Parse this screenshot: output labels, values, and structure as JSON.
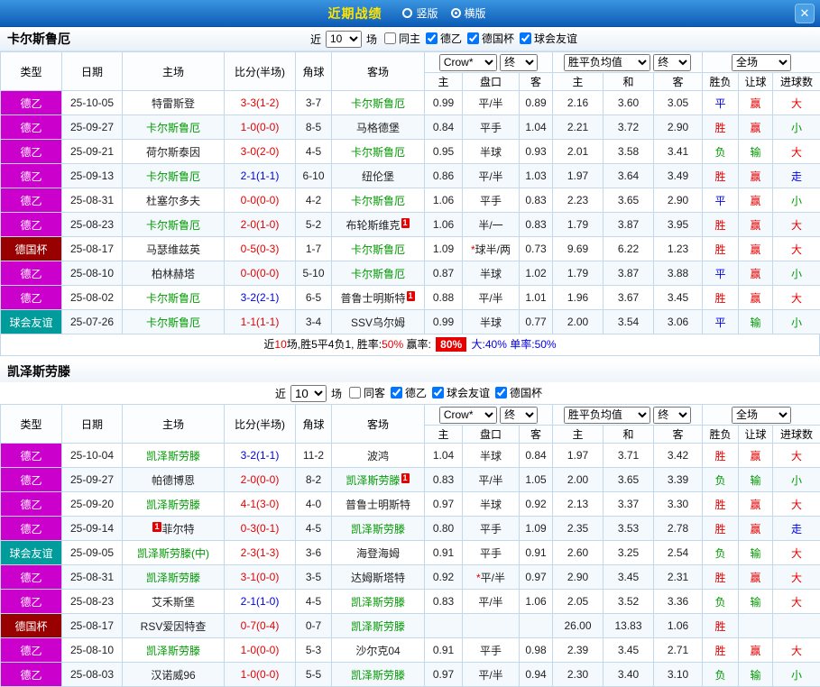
{
  "topbar": {
    "title": "近期战绩",
    "views": [
      {
        "label": "竖版",
        "selected": false
      },
      {
        "label": "横版",
        "selected": true
      }
    ],
    "close": "✕"
  },
  "filter_labels": {
    "near": "近",
    "games": "场"
  },
  "header_labels": {
    "type": "类型",
    "date": "日期",
    "home": "主场",
    "score": "比分(半场)",
    "corner": "角球",
    "away": "客场",
    "odds_main": "主",
    "odds_handicap": "盘口",
    "odds_away": "客",
    "eu_home": "主",
    "eu_draw": "和",
    "eu_away": "客",
    "res_wl": "胜负",
    "res_handicap": "让球",
    "res_goals": "进球数"
  },
  "selects": {
    "odds_source": "Crow*",
    "final1": "终",
    "europe": "胜平负均值",
    "final2": "终",
    "scope": "全场"
  },
  "colors": {
    "type_bg": {
      "德乙": "#cc00cc",
      "德国杯": "#990000",
      "球会友谊": "#009b9b"
    },
    "result_color": {
      "胜": "#e60000",
      "平": "#0000e6",
      "负": "#009900",
      "赢": "#e60000",
      "输": "#009900",
      "走": "#0000e6",
      "大": "#e60000",
      "小": "#009900"
    },
    "score_red": "#e60000",
    "score_blue": "#0000e6",
    "team_green": "#009900"
  },
  "sections": [
    {
      "team": "卡尔斯鲁厄",
      "filters": {
        "recent": "10",
        "checkboxes": [
          {
            "label": "同主",
            "checked": false
          },
          {
            "label": "德乙",
            "checked": true
          },
          {
            "label": "德国杯",
            "checked": true
          },
          {
            "label": "球会友谊",
            "checked": true
          }
        ]
      },
      "rows": [
        {
          "type": "德乙",
          "date": "25-10-05",
          "home": "特雷斯登",
          "home_green": false,
          "home_badge": "",
          "home_badge_pre": false,
          "score": "3-3(1-2)",
          "score_color": "red",
          "corner": "3-7",
          "away": "卡尔斯鲁厄",
          "away_green": true,
          "away_badge": "",
          "odds": [
            "0.99",
            "平/半",
            "0.89"
          ],
          "eu": [
            "2.16",
            "3.60",
            "3.05"
          ],
          "res": [
            "平",
            "赢",
            "大"
          ]
        },
        {
          "type": "德乙",
          "date": "25-09-27",
          "home": "卡尔斯鲁厄",
          "home_green": true,
          "home_badge": "",
          "home_badge_pre": false,
          "score": "1-0(0-0)",
          "score_color": "red",
          "corner": "8-5",
          "away": "马格德堡",
          "away_green": false,
          "away_badge": "",
          "odds": [
            "0.84",
            "平手",
            "1.04"
          ],
          "eu": [
            "2.21",
            "3.72",
            "2.90"
          ],
          "res": [
            "胜",
            "赢",
            "小"
          ]
        },
        {
          "type": "德乙",
          "date": "25-09-21",
          "home": "荷尔斯泰因",
          "home_green": false,
          "home_badge": "",
          "home_badge_pre": false,
          "score": "3-0(2-0)",
          "score_color": "red",
          "corner": "4-5",
          "away": "卡尔斯鲁厄",
          "away_green": true,
          "away_badge": "",
          "odds": [
            "0.95",
            "半球",
            "0.93"
          ],
          "eu": [
            "2.01",
            "3.58",
            "3.41"
          ],
          "res": [
            "负",
            "输",
            "大"
          ]
        },
        {
          "type": "德乙",
          "date": "25-09-13",
          "home": "卡尔斯鲁厄",
          "home_green": true,
          "home_badge": "",
          "home_badge_pre": false,
          "score": "2-1(1-1)",
          "score_color": "blue",
          "corner": "6-10",
          "away": "纽伦堡",
          "away_green": false,
          "away_badge": "",
          "odds": [
            "0.86",
            "平/半",
            "1.03"
          ],
          "eu": [
            "1.97",
            "3.64",
            "3.49"
          ],
          "res": [
            "胜",
            "赢",
            "走"
          ]
        },
        {
          "type": "德乙",
          "date": "25-08-31",
          "home": "杜塞尔多夫",
          "home_green": false,
          "home_badge": "",
          "home_badge_pre": false,
          "score": "0-0(0-0)",
          "score_color": "red",
          "corner": "4-2",
          "away": "卡尔斯鲁厄",
          "away_green": true,
          "away_badge": "",
          "odds": [
            "1.06",
            "平手",
            "0.83"
          ],
          "eu": [
            "2.23",
            "3.65",
            "2.90"
          ],
          "res": [
            "平",
            "赢",
            "小"
          ]
        },
        {
          "type": "德乙",
          "date": "25-08-23",
          "home": "卡尔斯鲁厄",
          "home_green": true,
          "home_badge": "",
          "home_badge_pre": false,
          "score": "2-0(1-0)",
          "score_color": "red",
          "corner": "5-2",
          "away": "布轮斯维克",
          "away_green": false,
          "away_badge": "1",
          "odds": [
            "1.06",
            "半/一",
            "0.83"
          ],
          "eu": [
            "1.79",
            "3.87",
            "3.95"
          ],
          "res": [
            "胜",
            "赢",
            "大"
          ]
        },
        {
          "type": "德国杯",
          "date": "25-08-17",
          "home": "马瑟维兹英",
          "home_green": false,
          "home_badge": "",
          "home_badge_pre": false,
          "score": "0-5(0-3)",
          "score_color": "red",
          "corner": "1-7",
          "away": "卡尔斯鲁厄",
          "away_green": true,
          "away_badge": "",
          "odds": [
            "1.09",
            "*球半/两",
            "0.73"
          ],
          "eu": [
            "9.69",
            "6.22",
            "1.23"
          ],
          "res": [
            "胜",
            "赢",
            "大"
          ]
        },
        {
          "type": "德乙",
          "date": "25-08-10",
          "home": "柏林赫塔",
          "home_green": false,
          "home_badge": "",
          "home_badge_pre": false,
          "score": "0-0(0-0)",
          "score_color": "red",
          "corner": "5-10",
          "away": "卡尔斯鲁厄",
          "away_green": true,
          "away_badge": "",
          "odds": [
            "0.87",
            "半球",
            "1.02"
          ],
          "eu": [
            "1.79",
            "3.87",
            "3.88"
          ],
          "res": [
            "平",
            "赢",
            "小"
          ]
        },
        {
          "type": "德乙",
          "date": "25-08-02",
          "home": "卡尔斯鲁厄",
          "home_green": true,
          "home_badge": "",
          "home_badge_pre": false,
          "score": "3-2(2-1)",
          "score_color": "blue",
          "corner": "6-5",
          "away": "普鲁士明斯特",
          "away_green": false,
          "away_badge": "1",
          "odds": [
            "0.88",
            "平/半",
            "1.01"
          ],
          "eu": [
            "1.96",
            "3.67",
            "3.45"
          ],
          "res": [
            "胜",
            "赢",
            "大"
          ]
        },
        {
          "type": "球会友谊",
          "date": "25-07-26",
          "home": "卡尔斯鲁厄",
          "home_green": true,
          "home_badge": "",
          "home_badge_pre": false,
          "score": "1-1(1-1)",
          "score_color": "red",
          "corner": "3-4",
          "away": "SSV乌尔姆",
          "away_green": false,
          "away_badge": "",
          "odds": [
            "0.99",
            "半球",
            "0.77"
          ],
          "eu": [
            "2.00",
            "3.54",
            "3.06"
          ],
          "res": [
            "平",
            "输",
            "小"
          ]
        }
      ],
      "summary": [
        {
          "text": "近",
          "cls": "plain"
        },
        {
          "text": "10",
          "cls": "red"
        },
        {
          "text": "场,胜5平4负1, 胜率:",
          "cls": "plain"
        },
        {
          "text": "50%",
          "cls": "red"
        },
        {
          "text": " 赢率: ",
          "cls": "plain"
        },
        {
          "text": "80%",
          "cls": "badge"
        },
        {
          "text": " 大:",
          "cls": "blue"
        },
        {
          "text": "40%",
          "cls": "blue"
        },
        {
          "text": " 单率:",
          "cls": "blue"
        },
        {
          "text": "50%",
          "cls": "blue"
        }
      ]
    },
    {
      "team": "凯泽斯劳滕",
      "filters": {
        "recent": "10",
        "checkboxes": [
          {
            "label": "同客",
            "checked": false
          },
          {
            "label": "德乙",
            "checked": true
          },
          {
            "label": "球会友谊",
            "checked": true
          },
          {
            "label": "德国杯",
            "checked": true
          }
        ]
      },
      "rows": [
        {
          "type": "德乙",
          "date": "25-10-04",
          "home": "凯泽斯劳滕",
          "home_green": true,
          "home_badge": "",
          "home_badge_pre": false,
          "score": "3-2(1-1)",
          "score_color": "blue",
          "corner": "11-2",
          "away": "波鸿",
          "away_green": false,
          "away_badge": "",
          "odds": [
            "1.04",
            "半球",
            "0.84"
          ],
          "eu": [
            "1.97",
            "3.71",
            "3.42"
          ],
          "res": [
            "胜",
            "赢",
            "大"
          ]
        },
        {
          "type": "德乙",
          "date": "25-09-27",
          "home": "帕德博恩",
          "home_green": false,
          "home_badge": "",
          "home_badge_pre": false,
          "score": "2-0(0-0)",
          "score_color": "red",
          "corner": "8-2",
          "away": "凯泽斯劳滕",
          "away_green": true,
          "away_badge": "1",
          "odds": [
            "0.83",
            "平/半",
            "1.05"
          ],
          "eu": [
            "2.00",
            "3.65",
            "3.39"
          ],
          "res": [
            "负",
            "输",
            "小"
          ]
        },
        {
          "type": "德乙",
          "date": "25-09-20",
          "home": "凯泽斯劳滕",
          "home_green": true,
          "home_badge": "",
          "home_badge_pre": false,
          "score": "4-1(3-0)",
          "score_color": "red",
          "corner": "4-0",
          "away": "普鲁士明斯特",
          "away_green": false,
          "away_badge": "",
          "odds": [
            "0.97",
            "半球",
            "0.92"
          ],
          "eu": [
            "2.13",
            "3.37",
            "3.30"
          ],
          "res": [
            "胜",
            "赢",
            "大"
          ]
        },
        {
          "type": "德乙",
          "date": "25-09-14",
          "home": "菲尔特",
          "home_green": false,
          "home_badge": "1",
          "home_badge_pre": true,
          "score": "0-3(0-1)",
          "score_color": "red",
          "corner": "4-5",
          "away": "凯泽斯劳滕",
          "away_green": true,
          "away_badge": "",
          "odds": [
            "0.80",
            "平手",
            "1.09"
          ],
          "eu": [
            "2.35",
            "3.53",
            "2.78"
          ],
          "res": [
            "胜",
            "赢",
            "走"
          ]
        },
        {
          "type": "球会友谊",
          "date": "25-09-05",
          "home": "凯泽斯劳滕(中)",
          "home_green": true,
          "home_badge": "",
          "home_badge_pre": false,
          "score": "2-3(1-3)",
          "score_color": "red",
          "corner": "3-6",
          "away": "海登海姆",
          "away_green": false,
          "away_badge": "",
          "odds": [
            "0.91",
            "平手",
            "0.91"
          ],
          "eu": [
            "2.60",
            "3.25",
            "2.54"
          ],
          "res": [
            "负",
            "输",
            "大"
          ]
        },
        {
          "type": "德乙",
          "date": "25-08-31",
          "home": "凯泽斯劳滕",
          "home_green": true,
          "home_badge": "",
          "home_badge_pre": false,
          "score": "3-1(0-0)",
          "score_color": "red",
          "corner": "3-5",
          "away": "达姆斯塔特",
          "away_green": false,
          "away_badge": "",
          "odds": [
            "0.92",
            "*平/半",
            "0.97"
          ],
          "eu": [
            "2.90",
            "3.45",
            "2.31"
          ],
          "res": [
            "胜",
            "赢",
            "大"
          ]
        },
        {
          "type": "德乙",
          "date": "25-08-23",
          "home": "艾禾斯堡",
          "home_green": false,
          "home_badge": "",
          "home_badge_pre": false,
          "score": "2-1(1-0)",
          "score_color": "blue",
          "corner": "4-5",
          "away": "凯泽斯劳滕",
          "away_green": true,
          "away_badge": "",
          "odds": [
            "0.83",
            "平/半",
            "1.06"
          ],
          "eu": [
            "2.05",
            "3.52",
            "3.36"
          ],
          "res": [
            "负",
            "输",
            "大"
          ]
        },
        {
          "type": "德国杯",
          "date": "25-08-17",
          "home": "RSV爱因特查",
          "home_green": false,
          "home_badge": "",
          "home_badge_pre": false,
          "score": "0-7(0-4)",
          "score_color": "red",
          "corner": "0-7",
          "away": "凯泽斯劳滕",
          "away_green": true,
          "away_badge": "",
          "odds": [
            "",
            "",
            ""
          ],
          "eu": [
            "26.00",
            "13.83",
            "1.06"
          ],
          "res": [
            "胜",
            "",
            ""
          ]
        },
        {
          "type": "德乙",
          "date": "25-08-10",
          "home": "凯泽斯劳滕",
          "home_green": true,
          "home_badge": "",
          "home_badge_pre": false,
          "score": "1-0(0-0)",
          "score_color": "red",
          "corner": "5-3",
          "away": "沙尔克04",
          "away_green": false,
          "away_badge": "",
          "odds": [
            "0.91",
            "平手",
            "0.98"
          ],
          "eu": [
            "2.39",
            "3.45",
            "2.71"
          ],
          "res": [
            "胜",
            "赢",
            "大"
          ]
        },
        {
          "type": "德乙",
          "date": "25-08-03",
          "home": "汉诺威96",
          "home_green": false,
          "home_badge": "",
          "home_badge_pre": false,
          "score": "1-0(0-0)",
          "score_color": "red",
          "corner": "5-5",
          "away": "凯泽斯劳滕",
          "away_green": true,
          "away_badge": "",
          "odds": [
            "0.97",
            "平/半",
            "0.94"
          ],
          "eu": [
            "2.30",
            "3.40",
            "3.10"
          ],
          "res": [
            "负",
            "输",
            "小"
          ]
        }
      ]
    }
  ]
}
